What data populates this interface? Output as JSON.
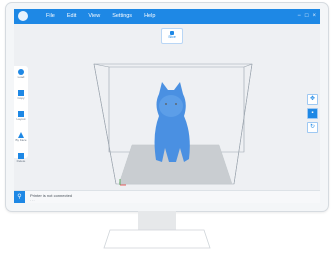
{
  "app": {
    "menu": [
      "File",
      "Edit",
      "View",
      "Settings",
      "Help"
    ],
    "window_controls": [
      "−",
      "□",
      "×"
    ]
  },
  "viewport": {
    "slice_button": "Slice"
  },
  "left_toolbar": [
    {
      "label": "Load",
      "icon": "load-icon"
    },
    {
      "label": "Copy",
      "icon": "copy-icon"
    },
    {
      "label": "Layout",
      "icon": "layout-icon"
    },
    {
      "label": "By Face",
      "icon": "by-face-icon"
    },
    {
      "label": "Delete",
      "icon": "delete-icon"
    }
  ],
  "right_toolbar": [
    {
      "icon": "move-icon",
      "glyph": "✥"
    },
    {
      "icon": "view-icon",
      "glyph": "▪"
    },
    {
      "icon": "reset-view-icon",
      "glyph": "↻"
    }
  ],
  "status": {
    "text": "Printer is not connected",
    "sub": "- - -"
  },
  "colors": {
    "accent": "#1e88e5",
    "model": "#4a90e2",
    "bed": "#c9cdd1"
  }
}
